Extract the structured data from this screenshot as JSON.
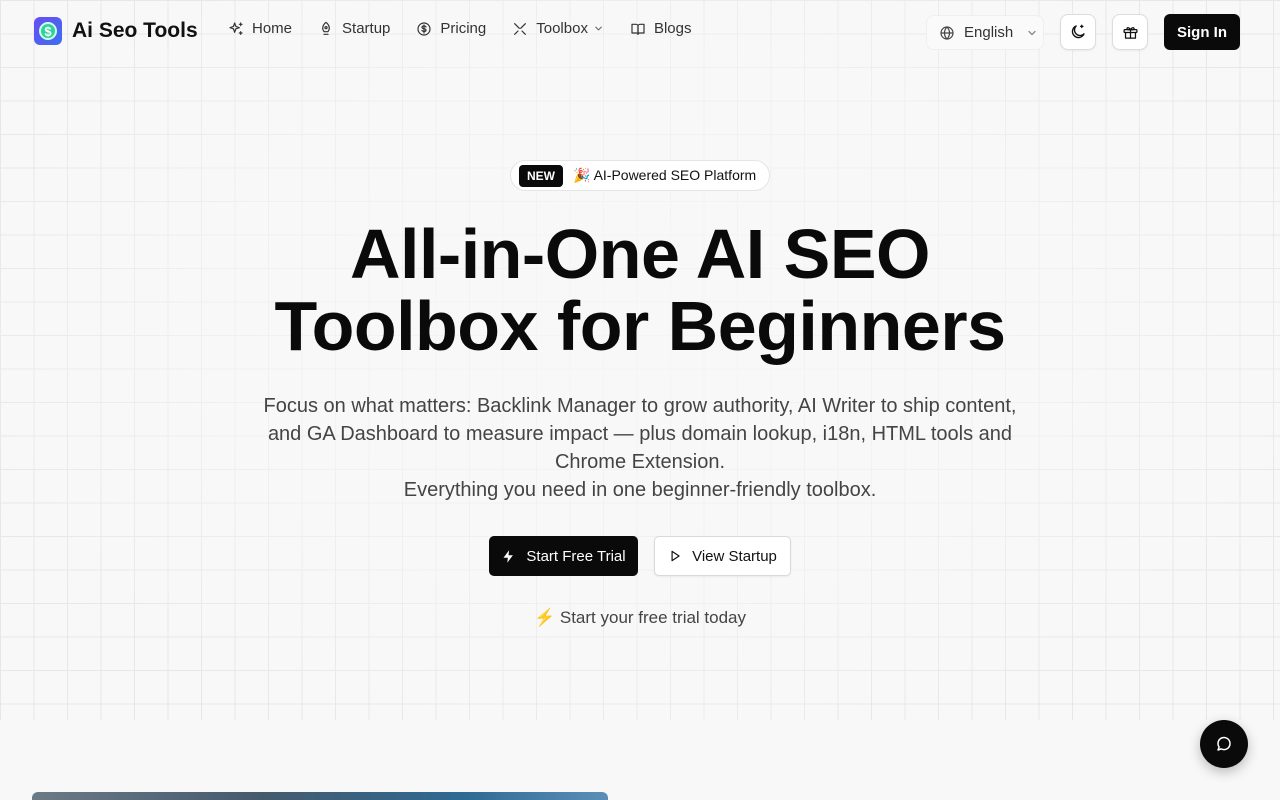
{
  "brand": {
    "name": "Ai Seo Tools",
    "logo_symbol": "$"
  },
  "nav": {
    "items": [
      {
        "label": "Home",
        "icon": "sparkles-icon"
      },
      {
        "label": "Startup",
        "icon": "rocket-icon"
      },
      {
        "label": "Pricing",
        "icon": "dollar-circle-icon"
      },
      {
        "label": "Toolbox",
        "icon": "tools-icon"
      },
      {
        "label": "Blogs",
        "icon": "book-icon"
      }
    ]
  },
  "language": {
    "selected": "English"
  },
  "header_actions": {
    "sign_in": "Sign In"
  },
  "hero": {
    "badge_new": "NEW",
    "badge_emoji": "🎉",
    "badge_text": "AI-Powered SEO Platform",
    "title_line1": "All-in-One AI SEO",
    "title_line2": "Toolbox for Beginners",
    "sub_line1": "Focus on what matters: Backlink Manager to grow authority, AI Writer to ship content, and GA Dashboard to measure impact — plus domain lookup, i18n, HTML tools and Chrome Extension.",
    "sub_line2": "Everything you need in one beginner-friendly toolbox.",
    "cta_primary": "Start Free Trial",
    "cta_secondary": "View Startup",
    "trial_emoji": "⚡",
    "trial_note": "Start your free trial today"
  },
  "colors": {
    "primary": "#0a0a0a",
    "background": "#f8f8f9",
    "logo_gradient_start": "#6a4cf5",
    "logo_gradient_end": "#3b6ff0",
    "logo_coin": "#2fd39a"
  }
}
